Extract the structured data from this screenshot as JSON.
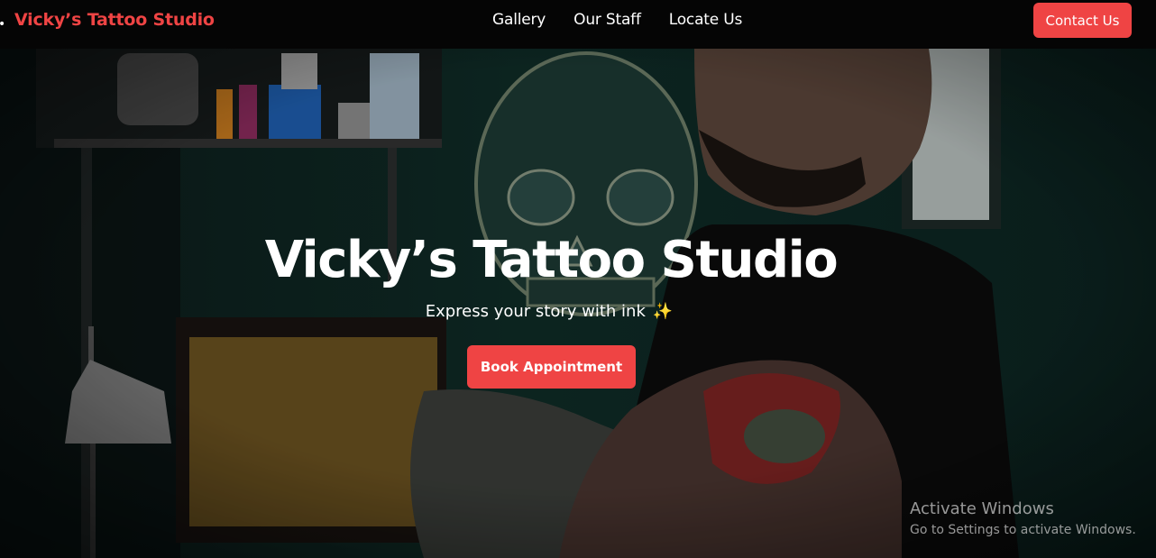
{
  "navbar": {
    "brand": "Vicky’s Tattoo Studio",
    "links": [
      "Gallery",
      "Our Staff",
      "Locate Us"
    ],
    "contact_label": "Contact Us"
  },
  "hero": {
    "title": "Vicky’s Tattoo Studio",
    "tagline": "Express your story with ink",
    "sparkle": "✨",
    "cta_label": "Book Appointment",
    "background_image": "tattoo-artist-photo"
  },
  "watermark": {
    "title": "Activate Windows",
    "subtitle": "Go to Settings to activate Windows."
  },
  "colors": {
    "accent": "#ef4444",
    "nav_bg": "#050505",
    "text": "#ffffff"
  }
}
